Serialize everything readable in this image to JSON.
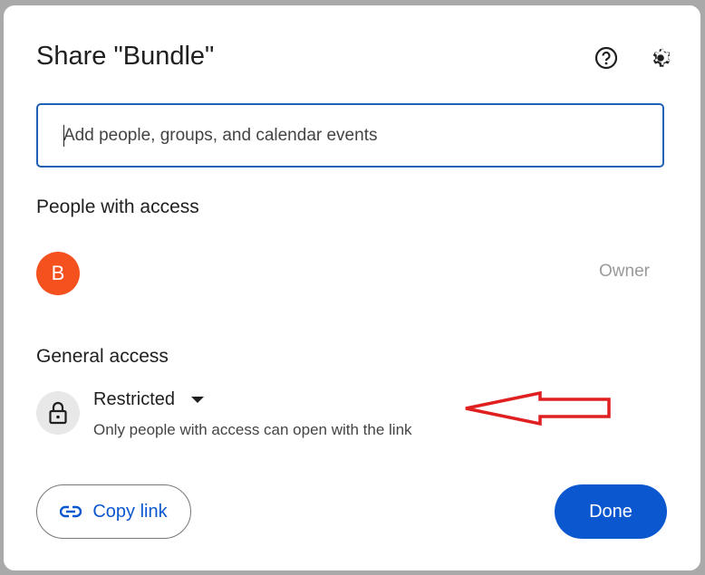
{
  "dialog": {
    "title": "Share \"Bundle\"",
    "help_icon": "help-circle-icon",
    "settings_icon": "gear-icon",
    "search": {
      "placeholder": "Add people, groups, and calendar events",
      "value": ""
    },
    "people_heading": "People with access",
    "people": [
      {
        "initial": "B",
        "avatar_color": "#f4511e",
        "role": "Owner"
      }
    ],
    "general_heading": "General access",
    "general_access": {
      "icon": "lock-icon",
      "value": "Restricted",
      "description": "Only people with access can open with the link"
    },
    "annotation_color": "#e02020",
    "copy_link_label": "Copy link",
    "done_label": "Done",
    "accent": "#0b57d0"
  }
}
